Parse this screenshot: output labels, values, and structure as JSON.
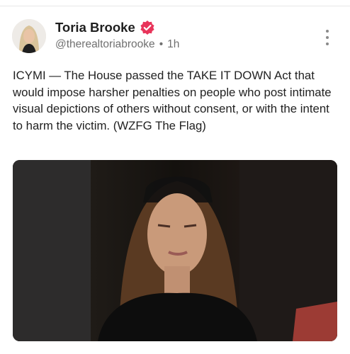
{
  "post": {
    "author": {
      "display_name": "Toria Brooke",
      "handle": "@therealtoriabrooke",
      "verified": true,
      "verified_color": "#e8345a"
    },
    "separator": "•",
    "timestamp": "1h",
    "text": "ICYMI — The House passed the TAKE IT DOWN Act that would impose harsher penalties on people who post intimate visual depictions of others without consent, or with the intent to harm the victim. (WZFG The Flag)",
    "icons": {
      "avatar": "profile-photo",
      "verified": "verified-badge-icon",
      "more": "vertical-ellipsis-icon"
    }
  }
}
